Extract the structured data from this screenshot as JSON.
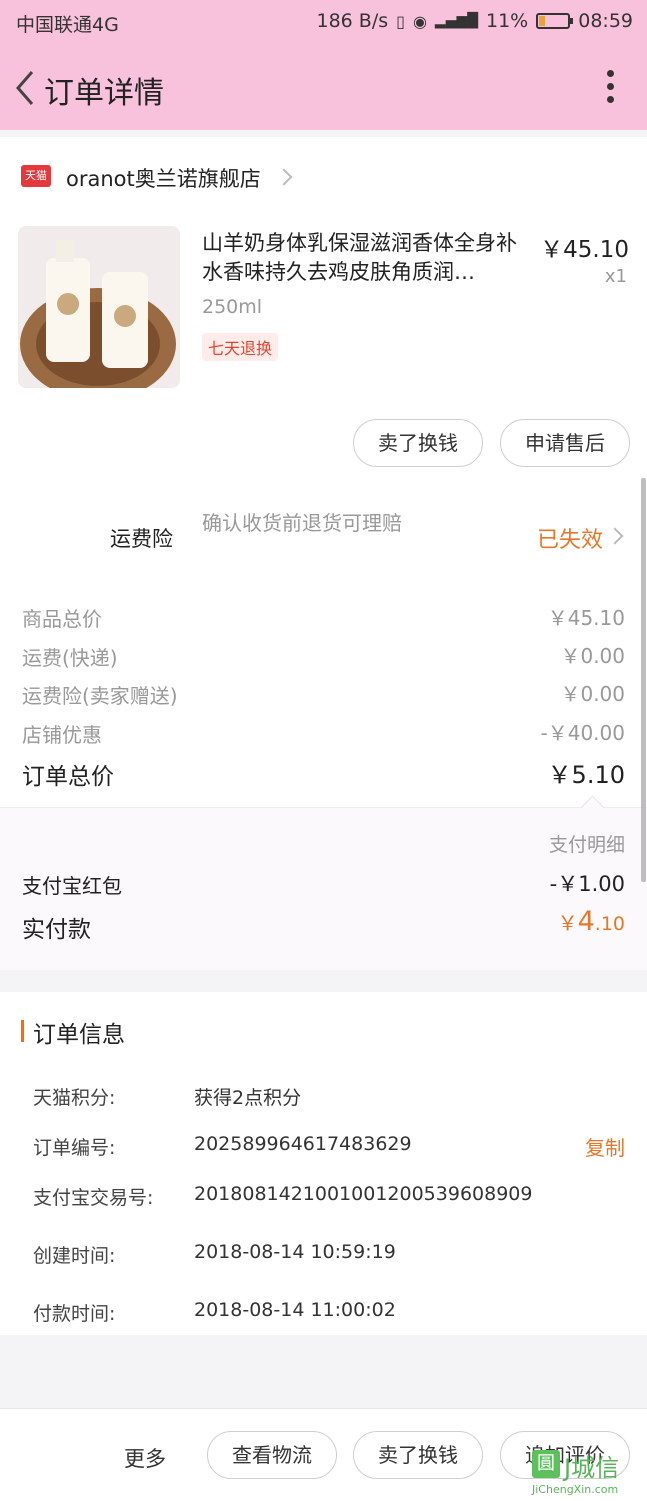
{
  "status": {
    "carrier": "中国联通4G",
    "speed": "186 B/s",
    "battery": "11%",
    "time": "08:59"
  },
  "nav": {
    "title": "订单详情"
  },
  "shop": {
    "badge": "天猫",
    "name": "oranot奥兰诺旗舰店"
  },
  "product": {
    "title": "山羊奶身体乳保湿滋润香体全身补水香味持久去鸡皮肤角质润…",
    "price": "￥45.10",
    "qty": "x1",
    "spec": "250ml",
    "tag": "七天退换"
  },
  "item_actions": {
    "sell": "卖了换钱",
    "aftersale": "申请售后"
  },
  "shipping_insurance": {
    "label": "运费险",
    "desc": "确认收货前退货可理赔",
    "status": "已失效"
  },
  "price_rows": [
    {
      "label": "商品总价",
      "value": "￥45.10"
    },
    {
      "label": "运费(快递)",
      "value": "￥0.00"
    },
    {
      "label": "运费险(卖家赠送)",
      "value": "￥0.00"
    },
    {
      "label": "店铺优惠",
      "value": "-￥40.00"
    }
  ],
  "order_total": {
    "label": "订单总价",
    "value": "￥5.10"
  },
  "payment": {
    "detail_link": "支付明细",
    "redpacket_label": "支付宝红包",
    "redpacket_value": "-￥1.00",
    "paid_label": "实付款",
    "paid_symbol": "￥",
    "paid_int": "4",
    "paid_dec": ".10"
  },
  "order_info": {
    "title": "订单信息",
    "copy": "复制",
    "rows": [
      {
        "label": "天猫积分:",
        "value": "获得2点积分"
      },
      {
        "label": "订单编号:",
        "value": "202589964617483629"
      },
      {
        "label": "支付宝交易号:",
        "value": "2018081421001001200539608909"
      },
      {
        "label": "创建时间:",
        "value": "2018-08-14 10:59:19"
      },
      {
        "label": "付款时间:",
        "value": "2018-08-14 11:00:02"
      }
    ]
  },
  "bottom": {
    "more": "更多",
    "logistics": "查看物流",
    "sell": "卖了换钱",
    "review": "追加评价"
  },
  "watermark": {
    "box": "圓",
    "big": "J城信",
    "small": "JiChengXin.com"
  },
  "colors": {
    "nav_bg": "#f9c2dc",
    "accent_orange": "#e4782a",
    "tmall_red": "#e4393c"
  }
}
